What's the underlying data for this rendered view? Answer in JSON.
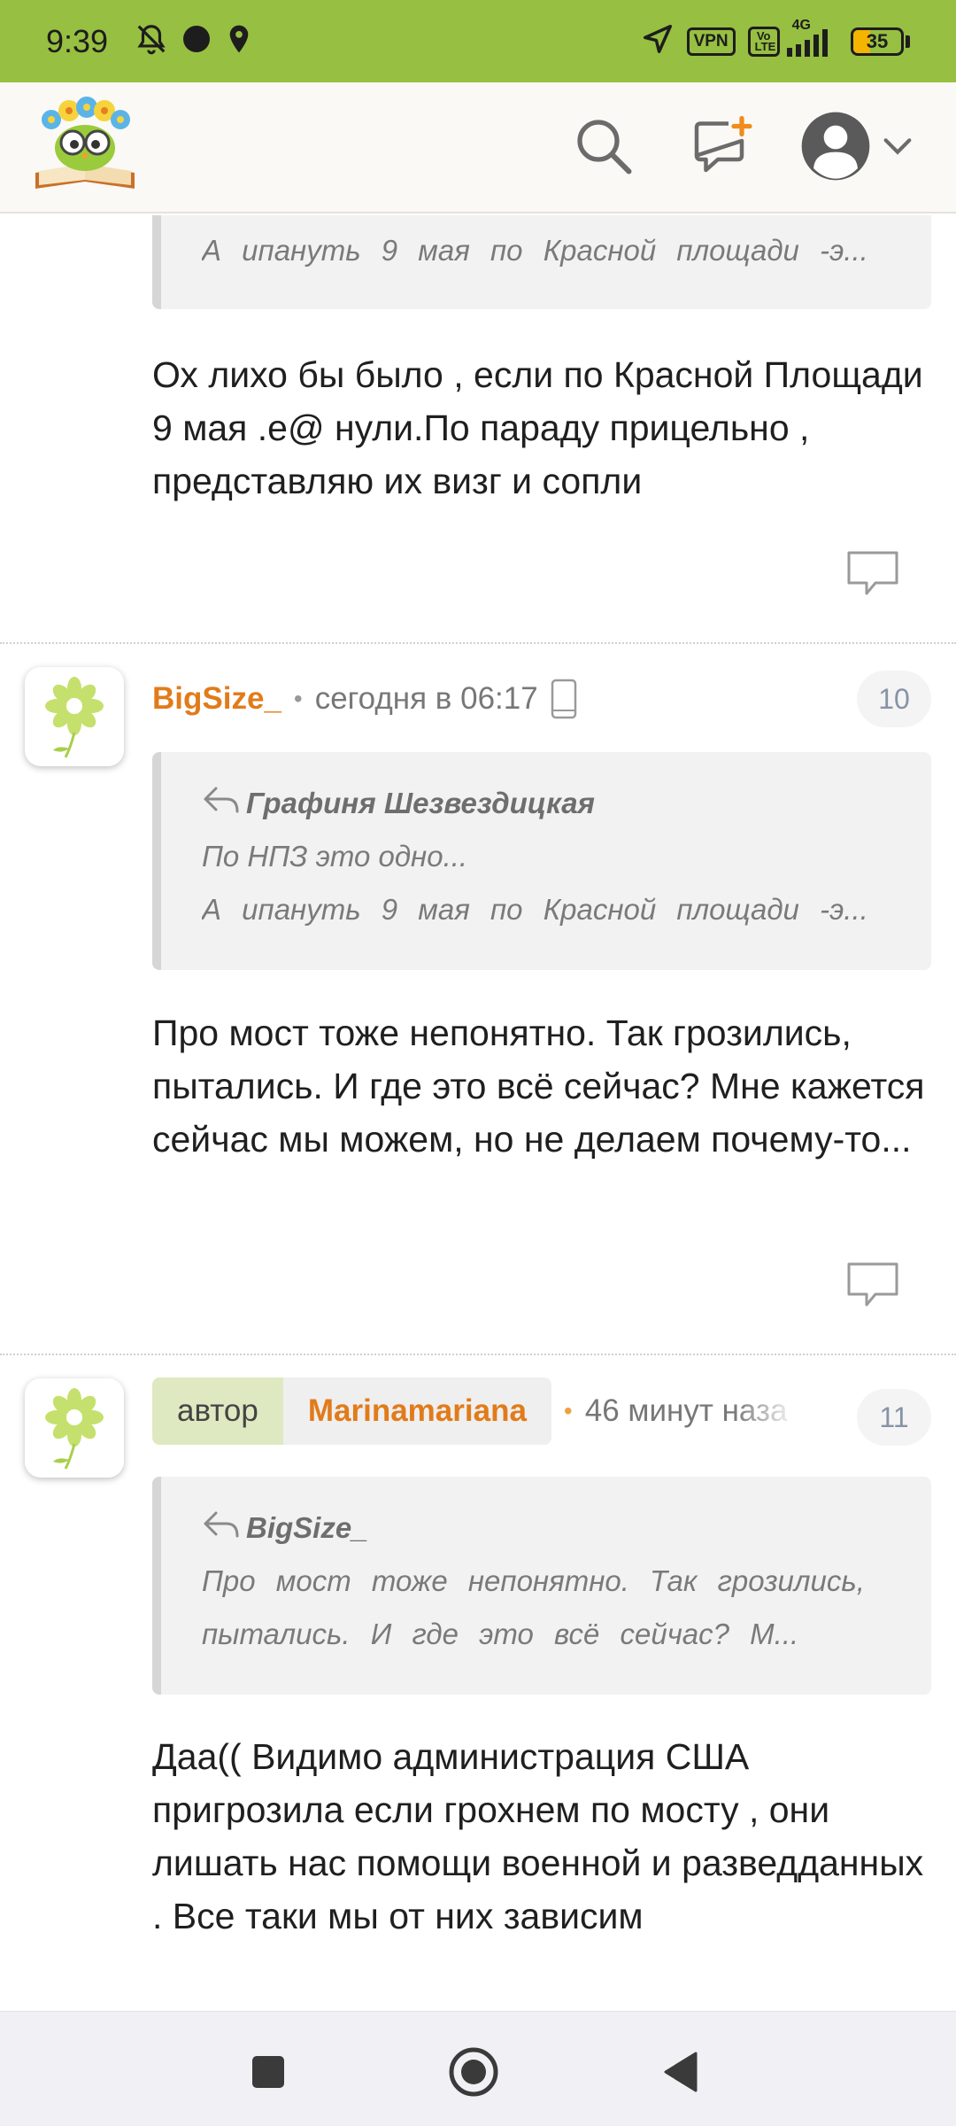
{
  "status_bar": {
    "time": "9:39",
    "vpn": "VPN",
    "volte": "Vo LTE",
    "network": "4G",
    "battery": "35",
    "battery_level": 0.35
  },
  "header": {
    "logo_icon": "owl-book-logo",
    "search_icon": "search-icon",
    "new_post_icon": "new-message-icon",
    "profile_icon": "user-avatar-icon"
  },
  "comments": [
    {
      "quote": {
        "text": "А ипануть 9 мая по Красной площади -э..."
      },
      "text": "Ох лихо бы было , если по Красной Площади 9 мая .е@ нули.По параду прицельно , представляю их визг и сопли"
    },
    {
      "author": "BigSize_",
      "time": "сегодня в 06:17",
      "number": "10",
      "quote": {
        "author": "Графиня Шезвездицкая",
        "line1": "По НПЗ это одно...",
        "line2": "А ипануть 9 мая по Красной площади -э..."
      },
      "text": "Про мост тоже непонятно. Так грозились, пытались. И где это всё сейчас? Мне кажется сейчас мы можем, но не делаем почему-то..."
    },
    {
      "role": "автор",
      "author": "Marinamariana",
      "time": "46 минут наза",
      "number": "11",
      "quote": {
        "author": "BigSize_",
        "line1": "Про мост тоже непонятно. Так грозились,",
        "line2": "пытались. И где это всё сейчас? М..."
      },
      "text": "Даа(( Видимо администрация США пригрозила если грохнем по мосту , они лишать нас помощи военной и разведданных . Все таки мы от них зависим"
    }
  ],
  "colors": {
    "status_bar": "#97bf41",
    "username": "#e17b1a",
    "author_badge": "#dfe9c1"
  }
}
